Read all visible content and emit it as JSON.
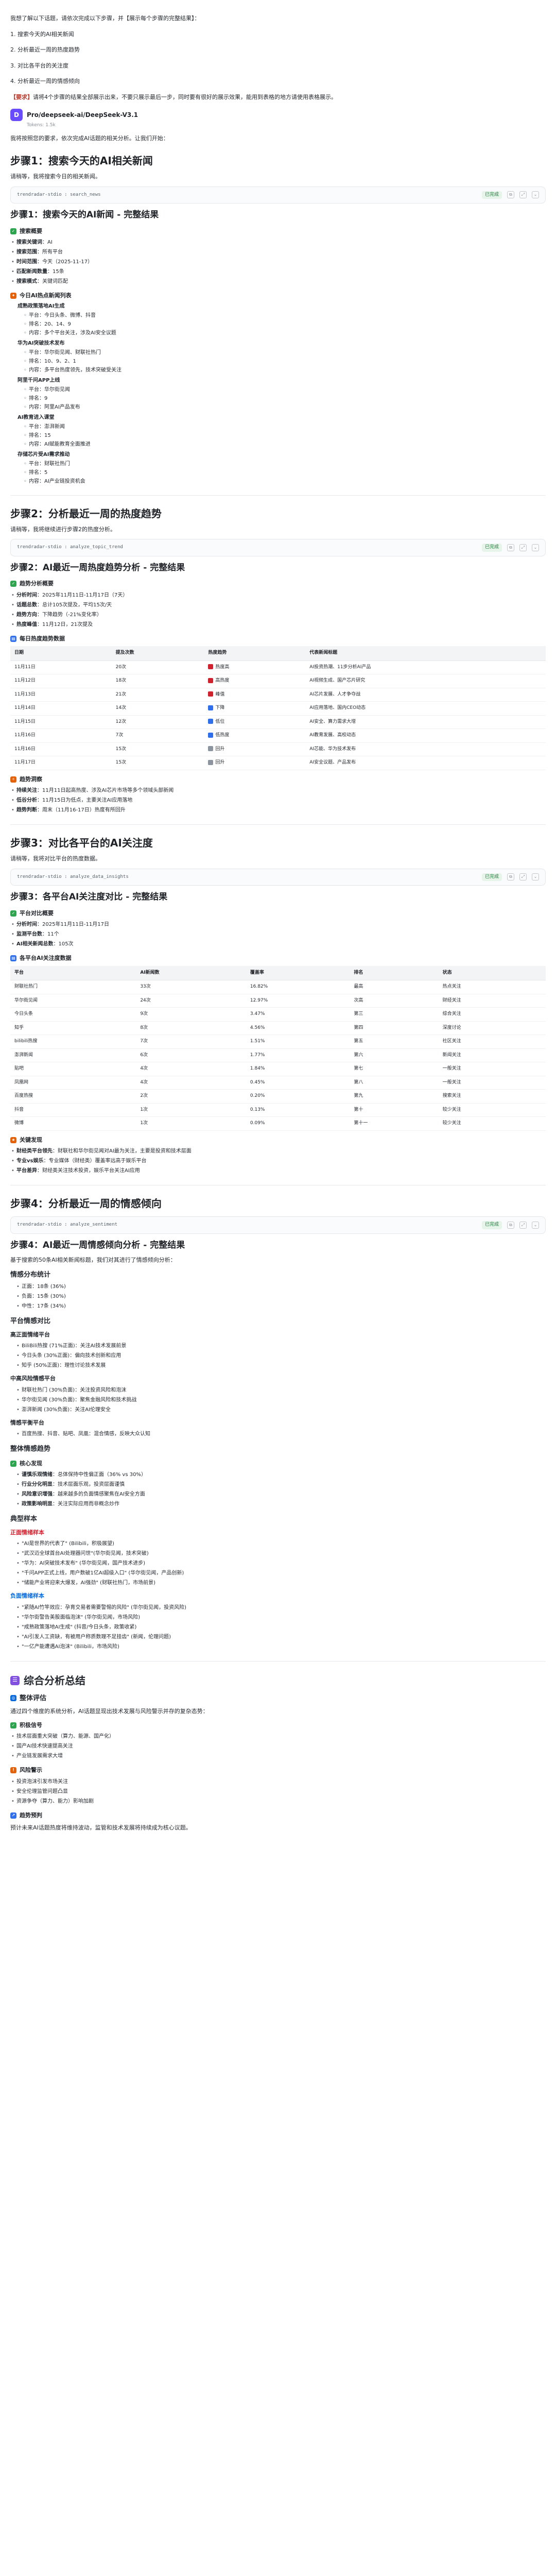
{
  "intro": {
    "line0_label": "我想了解",
    "line0": "以下话题，请依次完成以下步骤，并【展示每个步骤的完整结果】：",
    "steps": [
      "1. 搜索今天的AI相关新闻",
      "2. 分析最近一周的热度趋势",
      "3. 对比各平台的关注度",
      "4. 分析最近一周的情感倾向"
    ],
    "note_label": "【要求】",
    "note": "请将4个步骤的结果全部展示出来，不要只展示最后一步，同时要有很好的展示效果，能用到表格的地方请使用表格展示。"
  },
  "agent": {
    "avatar": "D",
    "name": "Pro/deepseek-ai/DeepSeek-V3.1",
    "sub": "Tokens: 1.5k",
    "opening": "我将按照您的要求，依次完成AI话题的相关分析。让我们开始："
  },
  "step1": {
    "title": "步骤1：搜索今天的AI相关新闻",
    "lead": "请稍等，我将搜索今日的相关新闻。",
    "tool": "trendradar-stdio : search_news",
    "status": "已完成",
    "result_title": "步骤1：搜索今天的AI新闻 - 完整结果",
    "overview_title": "搜索概要",
    "overview": [
      {
        "k": "搜索关键词",
        "v": "AI"
      },
      {
        "k": "搜索范围",
        "v": "所有平台"
      },
      {
        "k": "时间范围",
        "v": "今天（2025-11-17）"
      },
      {
        "k": "匹配新闻数量",
        "v": "15条"
      },
      {
        "k": "搜索模式",
        "v": "关键词匹配"
      }
    ],
    "hot_title": "今日AI热点新闻列表",
    "groups": [
      {
        "title": "成熟政策落地AI生成",
        "items": [
          "平台：今日头条、微博、抖音",
          "排名：20、14、9",
          "内容：多个平台关注，涉及AI安全议题"
        ]
      },
      {
        "title": "华为AI突破技术发布",
        "items": [
          "平台：华尔街见闻、财联社热门",
          "排名：10、9、2、1",
          "内容：多平台热度领先，技术突破受关注"
        ]
      },
      {
        "title": "阿里千问APP上线",
        "items": [
          "平台：华尔街见闻",
          "排名：9",
          "内容：阿里AI产品发布"
        ]
      },
      {
        "title": "AI教育进入课堂",
        "items": [
          "平台：澎湃新闻",
          "排名：15",
          "内容：AI赋能教育全面推进"
        ]
      },
      {
        "title": "存储芯片受AI需求推动",
        "items": [
          "平台：财联社热门",
          "排名：5",
          "内容：AI产业链投资机会"
        ]
      }
    ]
  },
  "step2": {
    "title": "步骤2：分析最近一周的热度趋势",
    "lead": "请稍等，我将继续进行步骤2的热度分析。",
    "tool": "trendradar-stdio : analyze_topic_trend",
    "status": "已完成",
    "result_title": "步骤2：AI最近一周热度趋势分析 - 完整结果",
    "overview_title": "趋势分析概要",
    "overview": [
      {
        "k": "分析时间",
        "v": "2025年11月11日-11月17日（7天）"
      },
      {
        "k": "话题总数",
        "v": "总计105次提及，平均15次/天"
      },
      {
        "k": "趋势方向",
        "v": "下降趋势（-21%变化率）"
      },
      {
        "k": "热度峰值",
        "v": "11月12日，21次提及"
      }
    ],
    "table_title": "每日热度趋势数据",
    "headers": [
      "日期",
      "提及次数",
      "热度趋势",
      "代表新闻标题"
    ],
    "rows": [
      {
        "date": "11月11日",
        "count": "20次",
        "trend": "热度高",
        "cls": "tr-up",
        "title": "AI投资热潮、11步分析AI产品"
      },
      {
        "date": "11月12日",
        "count": "18次",
        "trend": "高热度",
        "cls": "tr-up",
        "title": "AI视频生成、国产芯片研究"
      },
      {
        "date": "11月13日",
        "count": "21次",
        "trend": "峰值",
        "cls": "tr-up",
        "title": "AI芯片发展、人才争夺战"
      },
      {
        "date": "11月14日",
        "count": "14次",
        "trend": "下降",
        "cls": "tr-down",
        "title": "AI应用落地、国内CEO动态"
      },
      {
        "date": "11月15日",
        "count": "12次",
        "trend": "低位",
        "cls": "tr-down",
        "title": "AI安全、算力需求大增"
      },
      {
        "date": "11月16日",
        "count": "7次",
        "trend": "低热度",
        "cls": "tr-down",
        "title": "AI教育发展、高校动态"
      },
      {
        "date": "11月16日",
        "count": "15次",
        "trend": "回升",
        "cls": "tr-flat",
        "title": "AI芯能、华为技术发布"
      },
      {
        "date": "11月17日",
        "count": "15次",
        "trend": "回升",
        "cls": "tr-flat",
        "title": "AI安全议题、产品发布"
      }
    ],
    "insight_title": "趋势洞察",
    "insights": [
      {
        "k": "持续关注",
        "v": "11月11日起高热度、涉及AI芯片市场等多个领域头部新闻"
      },
      {
        "k": "低谷分析",
        "v": "11月15日为低点，主要关注AI应用落地"
      },
      {
        "k": "趋势判断",
        "v": "周末（11月16-17日）热度有所回升"
      }
    ]
  },
  "step3": {
    "title": "步骤3：对比各平台的AI关注度",
    "lead": "请稍等，我将对比平台的热度数据。",
    "tool": "trendradar-stdio : analyze_data_insights",
    "status": "已完成",
    "result_title": "步骤3：各平台AI关注度对比 - 完整结果",
    "overview_title": "平台对比概要",
    "overview": [
      {
        "k": "分析时间",
        "v": "2025年11月11日-11月17日"
      },
      {
        "k": "监测平台数",
        "v": "11个"
      },
      {
        "k": "AI相关新闻总数",
        "v": "105次"
      }
    ],
    "table_title": "各平台AI关注度数据",
    "headers": [
      "平台",
      "AI新闻数",
      "覆盖率",
      "排名",
      "状态"
    ],
    "rows": [
      {
        "p": "财联社热门",
        "n": "33次",
        "r": "16.82%",
        "rank": "最高",
        "s": "热点关注"
      },
      {
        "p": "华尔街见闻",
        "n": "24次",
        "r": "12.97%",
        "rank": "次高",
        "s": "财经关注"
      },
      {
        "p": "今日头条",
        "n": "9次",
        "r": "3.47%",
        "rank": "第三",
        "s": "综合关注"
      },
      {
        "p": "知乎",
        "n": "8次",
        "r": "4.56%",
        "rank": "第四",
        "s": "深度讨论"
      },
      {
        "p": "bilibili热搜",
        "n": "7次",
        "r": "1.51%",
        "rank": "第五",
        "s": "社区关注"
      },
      {
        "p": "澎湃新闻",
        "n": "6次",
        "r": "1.77%",
        "rank": "第六",
        "s": "新闻关注"
      },
      {
        "p": "贴吧",
        "n": "4次",
        "r": "1.84%",
        "rank": "第七",
        "s": "一般关注"
      },
      {
        "p": "凤凰网",
        "n": "4次",
        "r": "0.45%",
        "rank": "第八",
        "s": "一般关注"
      },
      {
        "p": "百度热搜",
        "n": "2次",
        "r": "0.20%",
        "rank": "第九",
        "s": "搜索关注"
      },
      {
        "p": "抖音",
        "n": "1次",
        "r": "0.13%",
        "rank": "第十",
        "s": "较少关注"
      },
      {
        "p": "微博",
        "n": "1次",
        "r": "0.09%",
        "rank": "第十一",
        "s": "较少关注"
      }
    ],
    "finding_title": "关键发现",
    "findings": [
      {
        "k": "财经类平台领先",
        "v": "财联社和华尔街见闻对AI最为关注，主要是投资和技术层面"
      },
      {
        "k": "专业vs娱乐",
        "v": "专业媒体（财经类）覆盖率远高于娱乐平台"
      },
      {
        "k": "平台差异",
        "v": "财经类关注技术投资，娱乐平台关注AI应用"
      }
    ]
  },
  "step4": {
    "title": "步骤4：分析最近一周的情感倾向",
    "tool": "trendradar-stdio : analyze_sentiment",
    "status": "已完成",
    "result_title": "步骤4：AI最近一周情感倾向分析 - 完整结果",
    "lead": "基于搜索的50条AI相关新闻标题，我们对其进行了情感倾向分析：",
    "dist_title": "情感分布统计",
    "dist": [
      "正面：18条 (36%)",
      "负面：15条 (30%)",
      "中性：17条 (34%)"
    ],
    "platform_title": "平台情感对比",
    "pos_title": "高正面情绪平台",
    "pos_items": [
      "BiliBili热搜 (71%正面)：关注AI技术发展前景",
      "今日头条 (30%正面)：偏向技术创新和应用",
      "知乎 (50%正面)：理性讨论技术发展"
    ],
    "mid_title": "中高风险情感平台",
    "mid_items": [
      "财联社热门 (30%负面)：关注投资风险和泡沫",
      "华尔街见闻 (30%负面)：聚焦金融风险和技术挑战",
      "澎湃新闻 (30%负面)：关注AI伦理安全"
    ],
    "neutral_title": "情感平衡平台",
    "neutral_items": [
      "百度热搜、抖音、贴吧、凤凰：混合情感，反映大众认知"
    ],
    "theme_title": "整体情感趋势",
    "core_title": "核心发现",
    "core": [
      {
        "k": "谨慎乐观情绪",
        "v": "总体保持中性偏正面（36% vs 30%）"
      },
      {
        "k": "行业分化明显",
        "v": "技术层面乐观，投资层面谨慎"
      },
      {
        "k": "风险意识增强",
        "v": "越来越多的负面情感聚焦在AI安全方面"
      },
      {
        "k": "政策影响明显",
        "v": "关注实际应用而非概念炒作"
      }
    ],
    "typical_title": "典型样本",
    "good_title": "正面情绪样本",
    "good": [
      "\"AI是世界的代表了\" (Bilibili，积极展望)",
      "\"武汉迈全球首台AI处理器问世\"(华尔街见闻，技术突破)",
      "\"华为：AI突破技术发布\" (华尔街见闻，国产技术进步)",
      "\"千问APP正式上线，用户数破1亿AI超级入口\" (华尔街见闻，产品创新)",
      "\"储能产业将迎来大爆发，AI强劲\" (财联社热门，市场前景)"
    ],
    "bad_title": "负面情绪样本",
    "bad": [
      "\"紧随AI竹竿效应：孕育交易者需要警惕的风险\" (华尔街见闻，投资风险)",
      "\"华尔街警告美股面临泡沫\" (华尔街见闻，市场风险)",
      "\"成熟政策落地AI生成\" (抖音/今日头条，政策收紧)",
      "\"AI引发人工资缺，有被用户称质数理不足挂齿\" (新闻，伦理问题)",
      "\"一亿产能遭遇AI泡沫\" (Bilibili，市场风险)"
    ]
  },
  "summary": {
    "title": "综合分析总结",
    "overall_title": "整体评估",
    "overall_lead": "通过四个维度的系统分析，AI话题显现出技术发展与风险警示并存的复杂态势：",
    "pos_title": "积极信号",
    "pos": [
      "技术层面重大突破（算力、能源、国产化）",
      "国产AI技术快速提高关注",
      "产业链发展需求大增"
    ],
    "risk_title": "风险警示",
    "risk": [
      "投资泡沫引发市场关注",
      "安全伦理监管问题凸显",
      "资源争夺（算力、能力）影响加剧"
    ],
    "trend_title": "趋势预判",
    "trend": "预计未来AI话题热度将维持波动，监管和技术发展将持续成为核心议题。"
  }
}
